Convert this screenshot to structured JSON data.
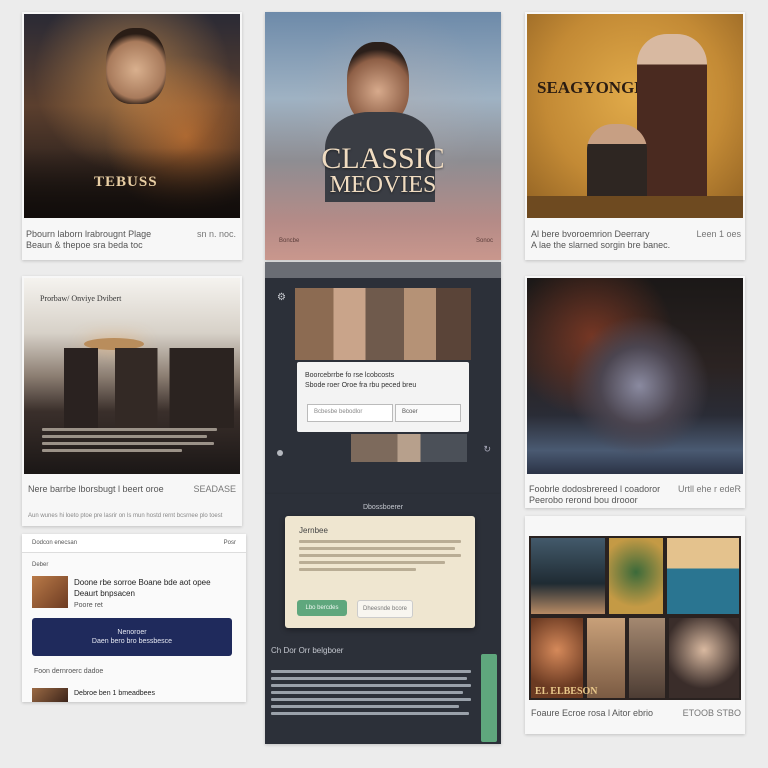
{
  "cards": {
    "c1": {
      "poster_title": "TEBUSS",
      "caption_line1": "Pbourn laborn lrabrougnt Plage",
      "caption_line2": "Beaun & thepoe sra beda toc",
      "caption_right": "sn n. noc."
    },
    "c2": {
      "title_line1": "CLASSIC",
      "title_line2": "MEOVIES",
      "footer_left": "Boncbe",
      "footer_right": "Sonoc"
    },
    "c3": {
      "poster_title": "SEAGYONGE",
      "caption_line1": "Al bere bvoroemrion Deerrary",
      "caption_line2": "A lae the slarned sorgin bre banec.",
      "caption_right": "Leen 1 oes"
    },
    "c4": {
      "header": "Prorbaw/ Onviye Dvibert",
      "caption_line1": "Nere barrbe lborsbugt l beert oroe",
      "caption_right": "SEADASE",
      "caption_line2": "Aun wunes hi loeto ptoe pre lasrir on ls mun hostd rernt bcsrnee plo toest"
    },
    "c5": {
      "nav_icon": "gear-icon",
      "dialog_line1": "Boorcebrrbe fo rse lcobcosts",
      "dialog_line2": "Sbode roer Oroe fra rbu peced breu",
      "input_placeholder": "Bcbesbe bebodlor",
      "input_button": "Bcoer",
      "footer_icon": "refresh-icon"
    },
    "c6": {
      "caption_line1": "Foobrle dodosbrereed l coadoror",
      "caption_line2": "Peerobo rerond bou drooor",
      "caption_right": "Urtll ehe r edeR"
    },
    "c7": {
      "header_left": "Dodcon enecsan",
      "header_right": "Posr",
      "section": "Deber",
      "item1_line1": "Doone rbe sorroe Boane bde aot opee",
      "item1_line2": "Deaurt bnpsacen",
      "item1_line3": "Poore ret",
      "cta_line1": "Nenoroer",
      "cta_line2": "Daen bero bro bessbesce",
      "section2": "Foon dernroerc dadoe",
      "item2_title": "Debroe ben 1 bmeadbees"
    },
    "c8": {
      "header": "Dbossboerer",
      "modal_title": "Jernbee",
      "btn_primary": "Lbo bercdes",
      "btn_secondary": "Dheesnde bcore",
      "section": "Ch Dor Orr belgboer"
    },
    "c9": {
      "overlay_text": "EL ELBESON",
      "caption_line1": "Foaure Ecroe rosa l Aitor ebrio",
      "caption_right": "ETOOB STBO"
    }
  },
  "colors": {
    "accent_navy": "#1f2a5c",
    "accent_green": "#5fa77d",
    "dark_panel": "#2c3039",
    "modal_bg": "#efe6d0"
  }
}
